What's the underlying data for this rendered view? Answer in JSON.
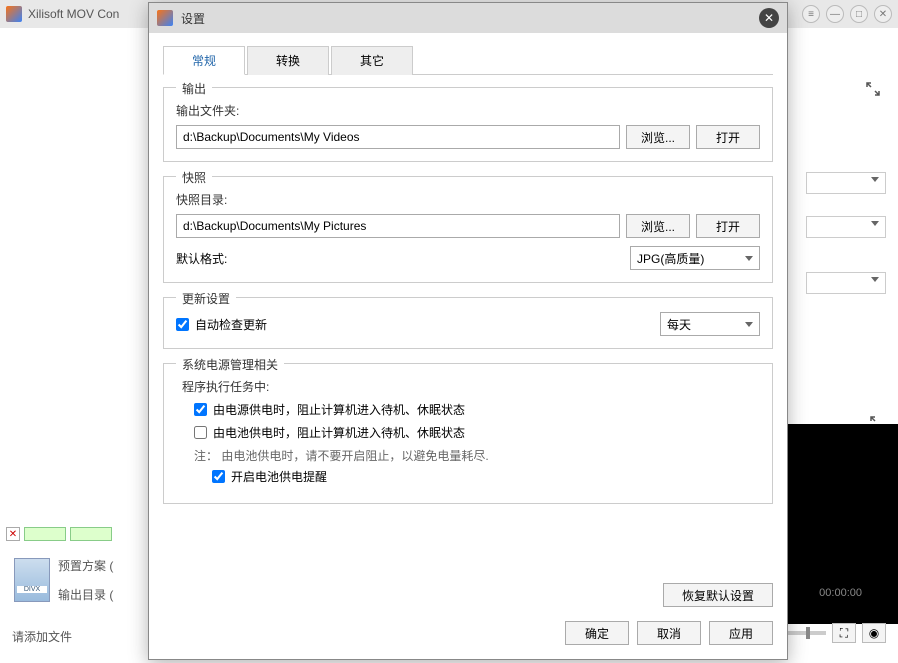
{
  "main": {
    "title": "Xilisoft MOV Con",
    "status": "请添加文件",
    "preset_label": "预置方案 (",
    "outdir_label": "输出目录 (",
    "preview_time": "00:00:00"
  },
  "dialog": {
    "title": "设置",
    "tabs": {
      "general": "常规",
      "convert": "转换",
      "other": "其它"
    },
    "output": {
      "group": "输出",
      "folder_label": "输出文件夹:",
      "folder_value": "d:\\Backup\\Documents\\My Videos",
      "browse": "浏览...",
      "open": "打开"
    },
    "snapshot": {
      "group": "快照",
      "folder_label": "快照目录:",
      "folder_value": "d:\\Backup\\Documents\\My Pictures",
      "browse": "浏览...",
      "open": "打开",
      "format_label": "默认格式:",
      "format_value": "JPG(高质量)"
    },
    "update": {
      "group": "更新设置",
      "auto_check": "自动检查更新",
      "frequency": "每天"
    },
    "power": {
      "group": "系统电源管理相关",
      "subtitle": "程序执行任务中:",
      "ac": "由电源供电时，阻止计算机进入待机、休眠状态",
      "battery": "由电池供电时，阻止计算机进入待机、休眠状态",
      "note": "注： 由电池供电时，请不要开启阻止，以避免电量耗尽.",
      "reminder": "开启电池供电提醒"
    },
    "footer": {
      "restore": "恢复默认设置",
      "ok": "确定",
      "cancel": "取消",
      "apply": "应用"
    }
  }
}
